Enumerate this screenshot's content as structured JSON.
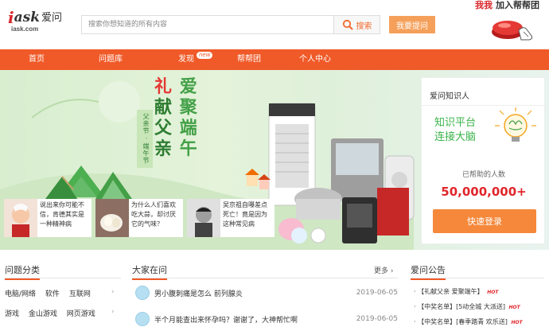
{
  "header": {
    "logo_i": "i",
    "logo_ask": "ask",
    "logo_cn": "爱问",
    "logo_domain": "iask.com",
    "search_placeholder": "搜索你想知道的所有内容",
    "search_button": "搜索",
    "ask_button": "我要提问",
    "join_my": "我我",
    "join_add": "加入帮帮团"
  },
  "nav": {
    "items": [
      "首页",
      "问题库",
      "发现",
      "帮帮团",
      "个人中心"
    ],
    "badge": "new"
  },
  "banner": {
    "title_chars": [
      "礼",
      "爱",
      "献",
      "聚",
      "父",
      "端",
      "亲",
      "午"
    ],
    "subtitle": "父亲节 · 端午节",
    "thumbs": [
      {
        "text": "说出来你可能不信，肯德其实是一种精神病"
      },
      {
        "text": "为什么人们喜欢吃大蒜，却讨厌它的气味？"
      },
      {
        "text": "吴京祖自曝差点死亡！竟是因为这种常见病"
      }
    ]
  },
  "panel": {
    "title": "爱问知识人",
    "slogan_line1": "知识平台",
    "slogan_line2": "连接大脑",
    "helped_label": "已帮助的人数",
    "helped_count": "50,000,000+",
    "login_button": "快速登录"
  },
  "sections": {
    "categories_title": "问题分类",
    "categories_rows": [
      [
        "电脑/网络",
        "软件",
        "互联网"
      ],
      [
        "游戏",
        "金山游戏",
        "网页游戏"
      ]
    ],
    "questions_title": "大家在问",
    "more_label": "更多",
    "questions": [
      {
        "text": "男小腹刺痛是怎么 前列腺炎",
        "date": "2019-06-05"
      },
      {
        "text": "半个月能查出来怀孕吗？谢谢了，大神帮忙啊",
        "date": "2019-06-05"
      }
    ],
    "announcements_title": "爱问公告",
    "announcements": [
      {
        "text": "【礼献父亲 爱聚端午】",
        "hot": "HOT"
      },
      {
        "text": "【中奖名单】[5动全城 大派送]",
        "hot": "HOT"
      },
      {
        "text": "【中奖名单】[春季踏青 欢乐送]",
        "hot": "HOT"
      }
    ]
  },
  "colors": {
    "brand_orange": "#f05a28",
    "brand_red": "#d9262a",
    "accent_green": "#3bb34a"
  }
}
